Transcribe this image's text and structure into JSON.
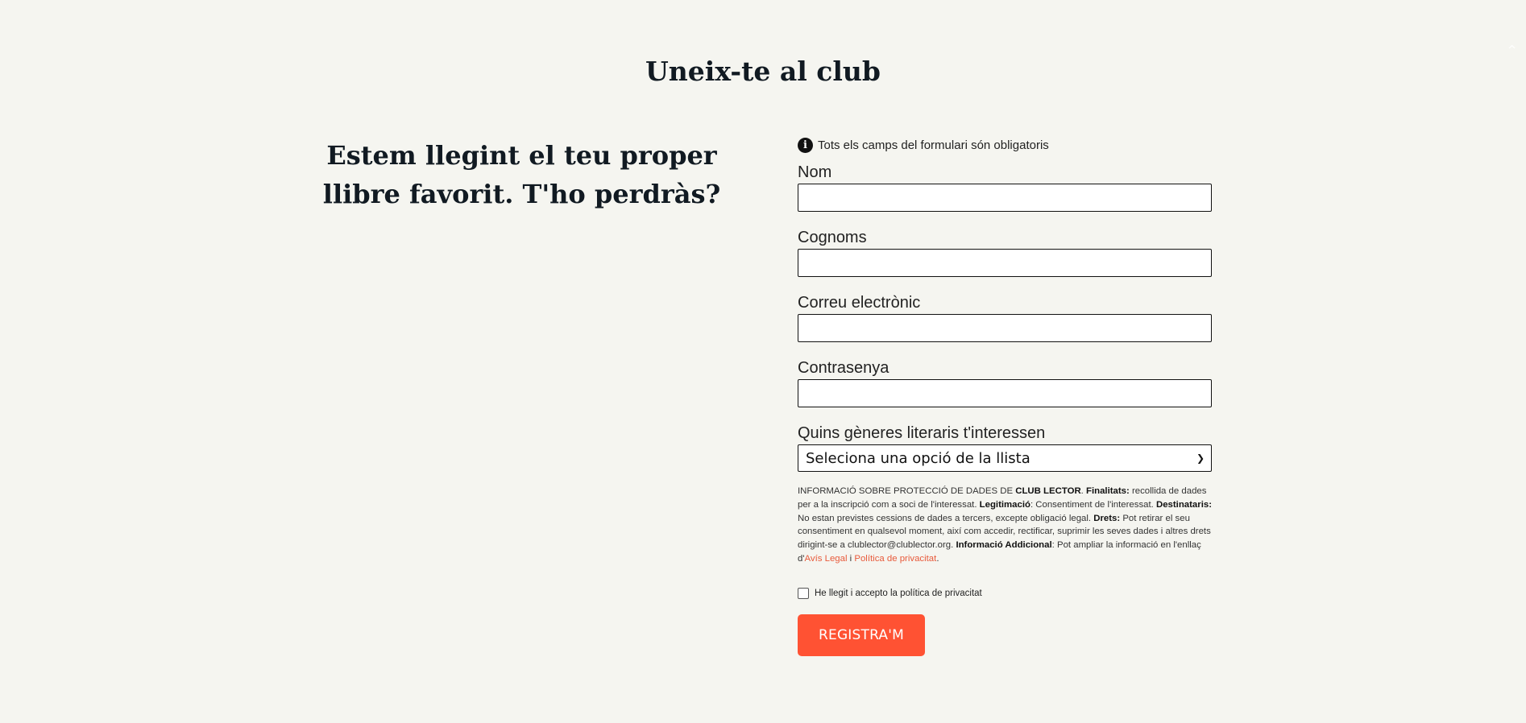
{
  "page": {
    "title": "Uneix-te al club",
    "tagline": "Estem llegint el teu proper llibre favorit. T'ho perdràs?",
    "scroll_top_glyph": "^"
  },
  "form": {
    "required_note": "Tots els camps del formulari són obligatoris",
    "fields": {
      "name": {
        "label": "Nom",
        "value": ""
      },
      "surname": {
        "label": "Cognoms",
        "value": ""
      },
      "email": {
        "label": "Correu electrònic",
        "value": ""
      },
      "password": {
        "label": "Contrasenya",
        "value": ""
      }
    },
    "genres": {
      "label": "Quins gèneres literaris t'interessen",
      "selected": "Seleciona una opció de la llista"
    },
    "privacy": {
      "p1": "INFORMACIÓ SOBRE PROTECCIÓ DE DADES DE ",
      "b1": "CLUB LECTOR",
      "p2": ". ",
      "b2": "Finalitats:",
      "p3": " recollida de dades per a la inscripció com a soci de l'interessat. ",
      "b3": "Legitimació",
      "p4": ": Consentiment de l'interessat. ",
      "b4": "Destinataris:",
      "p5": " No estan previstes cessions de dades a tercers, excepte obligació legal. ",
      "b5": "Drets:",
      "p6": " Pot retirar el seu consentiment en qualsevol moment, així com accedir, rectificar, suprimir les seves dades i altres drets dirigint-se a clublector@clublector.org. ",
      "b6": "Informació Addicional",
      "p7": ": Pot ampliar la informació en l'enllaç d'",
      "link_legal": "Avís Legal",
      "p8": " i ",
      "link_privacy": "Política de privacitat",
      "p9": "."
    },
    "accept_label": "He llegit i accepto la política de privacitat",
    "submit_label": "REGISTRA'M"
  },
  "colors": {
    "background": "#f5f5f0",
    "accent": "#ff5233",
    "link": "#e85a3b",
    "heading": "#111a22"
  },
  "icons": {
    "info": "info-circle-icon",
    "select": "chevron-down-icon",
    "scroll": "chevron-up-icon"
  }
}
